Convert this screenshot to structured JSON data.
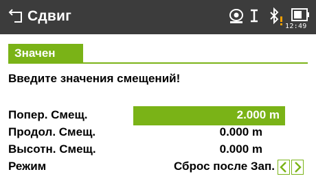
{
  "header": {
    "title": "Сдвиг",
    "time": "12:49",
    "icons": [
      "back-icon",
      "prism-icon",
      "text-input-icon",
      "bluetooth-warning-icon",
      "battery-icon"
    ]
  },
  "tab": {
    "label": "Значен"
  },
  "message": "Введите значения смещений!",
  "fields": [
    {
      "label": "Попер. Смещ.",
      "value": "2.000 m"
    },
    {
      "label": "Продол. Смещ.",
      "value": "0.000 m"
    },
    {
      "label": "Высотн. Смещ.",
      "value": "0.000 m"
    },
    {
      "label": "Режим",
      "value": "Сброс после Зап."
    }
  ],
  "colors": {
    "titlebar": "#3c3c3c",
    "accent": "#7ab317",
    "warning": "#f5a000"
  }
}
